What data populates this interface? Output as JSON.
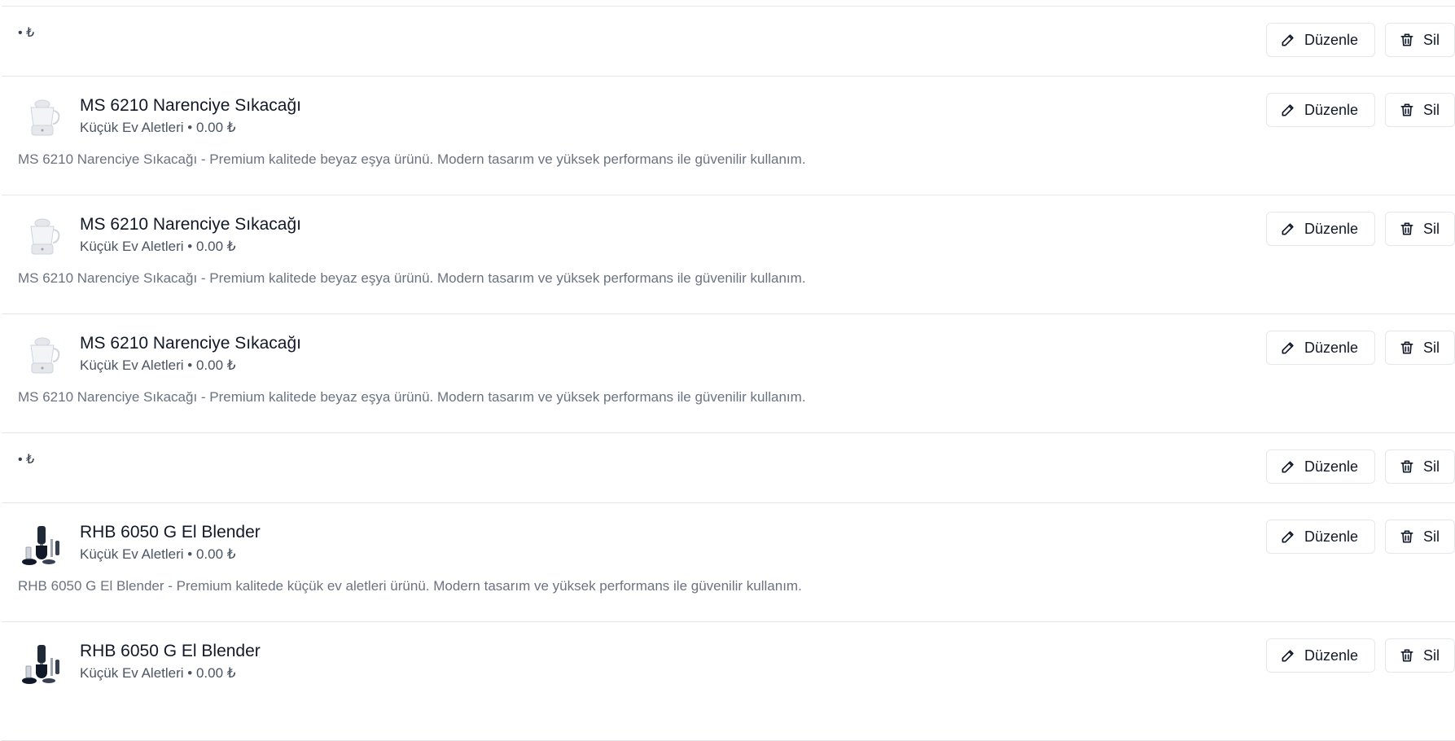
{
  "labels": {
    "edit": "Düzenle",
    "delete": "Sil"
  },
  "rows": [
    {
      "kind": "empty",
      "meta": "• ₺"
    },
    {
      "kind": "full",
      "image": "juicer",
      "title": "MS 6210 Narenciye Sıkacağı",
      "subtitle": "Küçük Ev Aletleri • 0.00 ₺",
      "description": "MS 6210 Narenciye Sıkacağı - Premium kalitede beyaz eşya ürünü. Modern tasarım ve yüksek performans ile güvenilir kullanım."
    },
    {
      "kind": "full",
      "image": "juicer",
      "title": "MS 6210 Narenciye Sıkacağı",
      "subtitle": "Küçük Ev Aletleri • 0.00 ₺",
      "description": "MS 6210 Narenciye Sıkacağı - Premium kalitede beyaz eşya ürünü. Modern tasarım ve yüksek performans ile güvenilir kullanım."
    },
    {
      "kind": "full",
      "image": "juicer",
      "title": "MS 6210 Narenciye Sıkacağı",
      "subtitle": "Küçük Ev Aletleri • 0.00 ₺",
      "description": "MS 6210 Narenciye Sıkacağı - Premium kalitede beyaz eşya ürünü. Modern tasarım ve yüksek performans ile güvenilir kullanım."
    },
    {
      "kind": "empty",
      "meta": "• ₺"
    },
    {
      "kind": "full",
      "image": "blender",
      "title": "RHB 6050 G El Blender",
      "subtitle": "Küçük Ev Aletleri • 0.00 ₺",
      "description": "RHB 6050 G El Blender - Premium kalitede küçük ev aletleri ürünü. Modern tasarım ve yüksek performans ile güvenilir kullanım."
    },
    {
      "kind": "full",
      "image": "blender",
      "title": "RHB 6050 G El Blender",
      "subtitle": "Küçük Ev Aletleri • 0.00 ₺",
      "description": ""
    }
  ],
  "icons": {
    "edit": "pencil-icon",
    "delete": "trash-icon"
  },
  "colors": {
    "border": "#e5e7eb",
    "text": "#111827",
    "muted": "#6b7280"
  }
}
